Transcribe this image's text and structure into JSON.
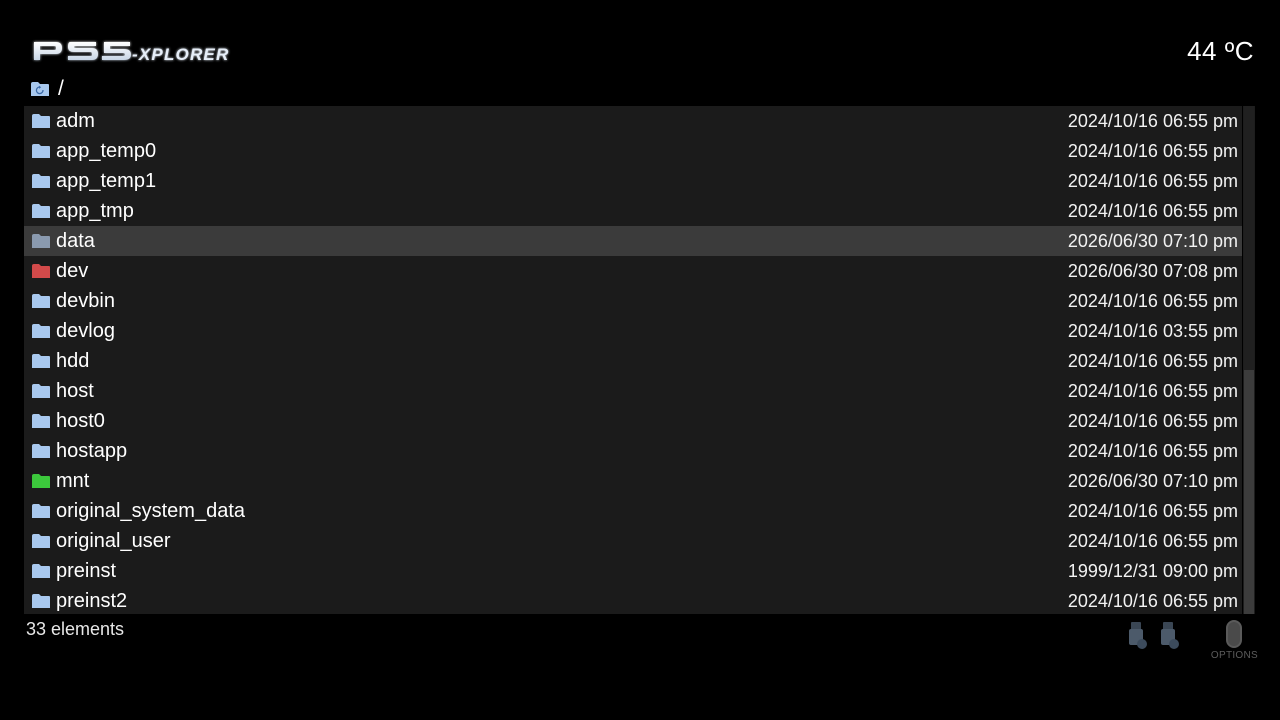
{
  "header": {
    "logo_text": "PS5-XPLORER",
    "temperature": "44 ºC"
  },
  "pathbar": {
    "path": "/",
    "icon": "refresh-folder-icon"
  },
  "files": [
    {
      "name": "adm",
      "date": "2024/10/16 06:55 pm",
      "icon_color": "#a8c8ee"
    },
    {
      "name": "app_temp0",
      "date": "2024/10/16 06:55 pm",
      "icon_color": "#a8c8ee"
    },
    {
      "name": "app_temp1",
      "date": "2024/10/16 06:55 pm",
      "icon_color": "#a8c8ee"
    },
    {
      "name": "app_tmp",
      "date": "2024/10/16 06:55 pm",
      "icon_color": "#a8c8ee"
    },
    {
      "name": "data",
      "date": "2026/06/30 07:10 pm",
      "icon_color": "#8a9aaf",
      "selected": true
    },
    {
      "name": "dev",
      "date": "2026/06/30 07:08 pm",
      "icon_color": "#d24a4a"
    },
    {
      "name": "devbin",
      "date": "2024/10/16 06:55 pm",
      "icon_color": "#a8c8ee"
    },
    {
      "name": "devlog",
      "date": "2024/10/16 03:55 pm",
      "icon_color": "#a8c8ee"
    },
    {
      "name": "hdd",
      "date": "2024/10/16 06:55 pm",
      "icon_color": "#a8c8ee"
    },
    {
      "name": "host",
      "date": "2024/10/16 06:55 pm",
      "icon_color": "#a8c8ee"
    },
    {
      "name": "host0",
      "date": "2024/10/16 06:55 pm",
      "icon_color": "#a8c8ee"
    },
    {
      "name": "hostapp",
      "date": "2024/10/16 06:55 pm",
      "icon_color": "#a8c8ee"
    },
    {
      "name": "mnt",
      "date": "2026/06/30 07:10 pm",
      "icon_color": "#3cc83c"
    },
    {
      "name": "original_system_data",
      "date": "2024/10/16 06:55 pm",
      "icon_color": "#a8c8ee"
    },
    {
      "name": "original_user",
      "date": "2024/10/16 06:55 pm",
      "icon_color": "#a8c8ee"
    },
    {
      "name": "preinst",
      "date": "1999/12/31 09:00 pm",
      "icon_color": "#a8c8ee"
    },
    {
      "name": "preinst2",
      "date": "2024/10/16 06:55 pm",
      "icon_color": "#a8c8ee"
    }
  ],
  "footer": {
    "count_text": "33 elements",
    "options_label": "OPTIONS",
    "usb_icons": [
      "usb-drive-icon",
      "usb-drive-icon"
    ]
  },
  "scroll": {
    "visible_fraction": 0.52,
    "position": 0.0
  }
}
